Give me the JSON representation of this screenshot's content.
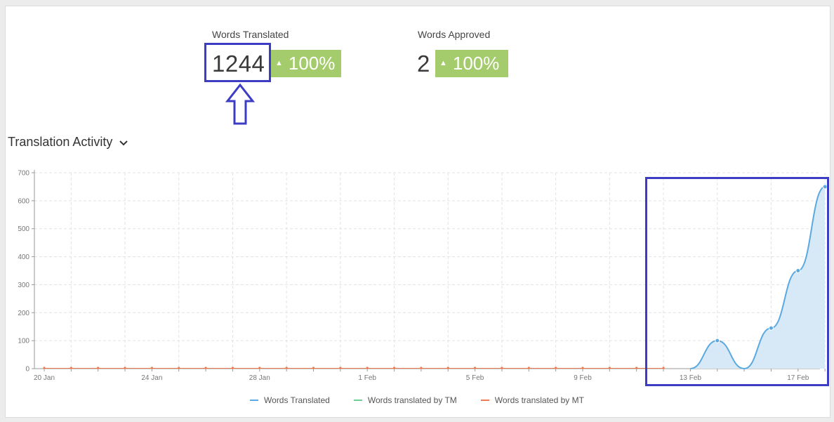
{
  "stats": [
    {
      "label": "Words Translated",
      "value": "1244",
      "change": "100%"
    },
    {
      "label": "Words Approved",
      "value": "2",
      "change": "100%"
    }
  ],
  "section": {
    "title": "Translation Activity"
  },
  "colors": {
    "words_translated": "#5aa9e0",
    "words_tm": "#6fcf8f",
    "words_mt": "#ef7a4e",
    "badge": "#a4cc6c",
    "highlight": "#3d3dc4"
  },
  "chart_data": {
    "type": "area",
    "x": [
      "20 Jan",
      "21 Jan",
      "22 Jan",
      "23 Jan",
      "24 Jan",
      "25 Jan",
      "26 Jan",
      "27 Jan",
      "28 Jan",
      "29 Jan",
      "30 Jan",
      "31 Jan",
      "1 Feb",
      "2 Feb",
      "3 Feb",
      "4 Feb",
      "5 Feb",
      "6 Feb",
      "7 Feb",
      "8 Feb",
      "9 Feb",
      "10 Feb",
      "11 Feb",
      "12 Feb",
      "13 Feb",
      "14 Feb",
      "15 Feb",
      "16 Feb",
      "17 Feb",
      "18 Feb"
    ],
    "x_tick_labels": [
      "20 Jan",
      "24 Jan",
      "28 Jan",
      "1 Feb",
      "5 Feb",
      "9 Feb",
      "13 Feb",
      "17 Feb"
    ],
    "y_ticks": [
      0,
      100,
      200,
      300,
      400,
      500,
      600,
      700
    ],
    "ylim": [
      0,
      700
    ],
    "series": [
      {
        "name": "Words Translated",
        "values": [
          0,
          0,
          0,
          0,
          0,
          0,
          0,
          0,
          0,
          0,
          0,
          0,
          0,
          0,
          0,
          0,
          0,
          0,
          0,
          0,
          0,
          0,
          0,
          0,
          0,
          100,
          0,
          145,
          350,
          650
        ]
      },
      {
        "name": "Words translated by TM",
        "values": [
          0,
          0,
          0,
          0,
          0,
          0,
          0,
          0,
          0,
          0,
          0,
          0,
          0,
          0,
          0,
          0,
          0,
          0,
          0,
          0,
          0,
          0,
          0,
          0,
          0,
          0,
          0,
          0,
          0,
          0
        ]
      },
      {
        "name": "Words translated by MT",
        "values": [
          0,
          0,
          0,
          0,
          0,
          0,
          0,
          0,
          0,
          0,
          0,
          0,
          0,
          0,
          0,
          0,
          0,
          0,
          0,
          0,
          0,
          0,
          0,
          0,
          0,
          0,
          0,
          0,
          0,
          0
        ]
      }
    ],
    "grid": true,
    "legend": "bottom-center"
  }
}
